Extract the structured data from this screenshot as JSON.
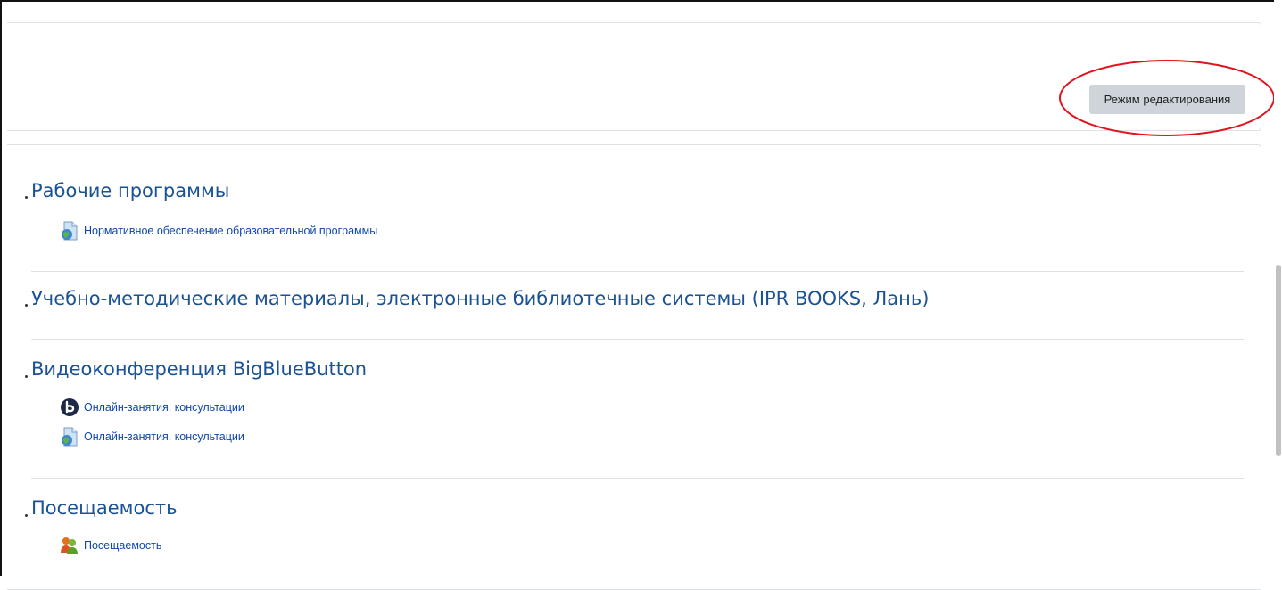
{
  "header": {
    "edit_mode_button": "Режим редактирования"
  },
  "sections": [
    {
      "title": "Рабочие программы",
      "activities": [
        {
          "icon": "url-resource-icon",
          "label": "Нормативное обеспечение образовательной программы"
        }
      ]
    },
    {
      "title": "Учебно-методические материалы, электронные библиотечные системы (IPR BOOKS, Лань)",
      "activities": []
    },
    {
      "title": "Видеоконференция BigBlueButton",
      "activities": [
        {
          "icon": "bigbluebutton-icon",
          "label": "Онлайн-занятия, консультации"
        },
        {
          "icon": "url-resource-icon",
          "label": "Онлайн-занятия, консультации"
        }
      ]
    },
    {
      "title": "Посещаемость",
      "activities": [
        {
          "icon": "attendance-icon",
          "label": "Посещаемость"
        }
      ]
    }
  ],
  "colors": {
    "link": "#0f47ad",
    "section_title": "#1a5294",
    "button_bg": "#ced4da",
    "highlight": "#e0141e"
  }
}
